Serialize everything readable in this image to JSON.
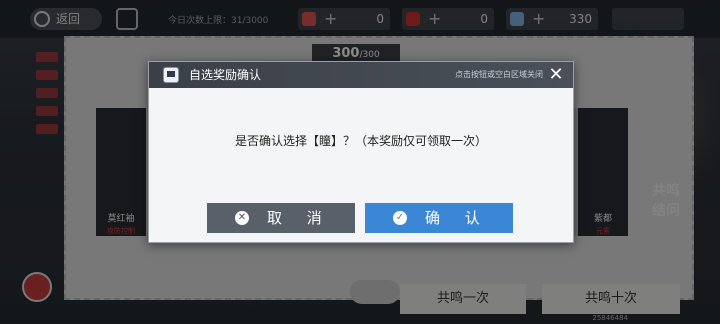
{
  "topbar": {
    "home_label": "返回",
    "daily_limit_text": "今日次数上限：31/3000",
    "resources": [
      {
        "value": "0",
        "color": "#d9534f"
      },
      {
        "value": "0",
        "color": "#c9302c"
      },
      {
        "value": "330",
        "color": "#7fb0e0"
      }
    ]
  },
  "ticket": {
    "counter": "300",
    "counter_total": "/300",
    "characters": [
      {
        "name": "莫红袖",
        "sub": "攻防控制"
      },
      {
        "name": "紫都",
        "sub": "元素"
      }
    ],
    "gacha_once": "共鸣一次",
    "gacha_ten": "共鸣十次",
    "right_text_1": "共鸣",
    "right_text_2": "结问",
    "uid": "25846484"
  },
  "dialog": {
    "title": "自选奖励确认",
    "hint": "点击按钮或空白区域关闭",
    "message": "是否确认选择【瞳】？（本奖励仅可领取一次）",
    "cancel_label": "取 消",
    "confirm_label": "确 认",
    "header_color": "#3b4048",
    "confirm_color": "#3b87d6",
    "cancel_color": "#59606a"
  }
}
